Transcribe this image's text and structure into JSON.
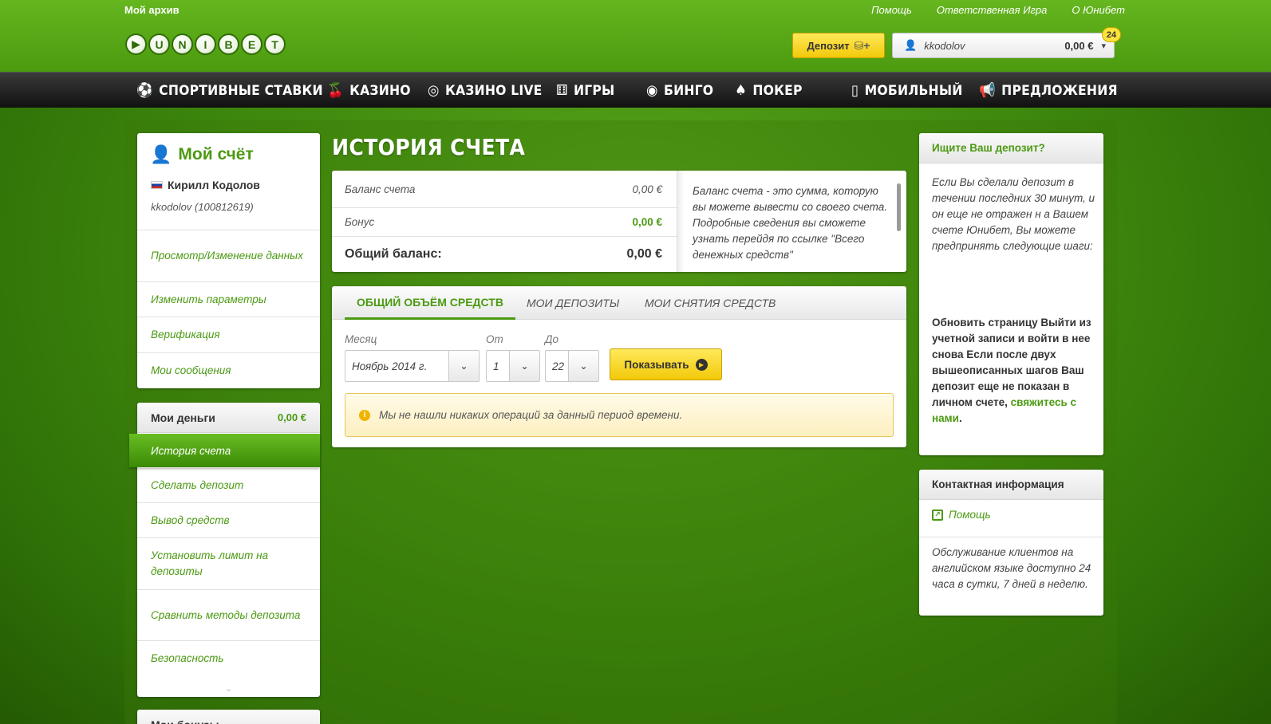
{
  "top": {
    "archive": "Мой архив",
    "links": [
      "Помощь",
      "Ответственная Игра",
      "О Юнибет"
    ],
    "logo_letters": [
      "▶",
      "U",
      "N",
      "I",
      "B",
      "E",
      "T"
    ],
    "deposit_button": "Депозит",
    "username": "kkodolov",
    "balance": "0,00 €",
    "notifications": "24"
  },
  "nav": [
    "СПОРТИВНЫЕ СТАВКИ",
    "КАЗИНО",
    "КАЗИНО LIVE",
    "ИГРЫ",
    "БИНГО",
    "ПОКЕР",
    "МОБИЛЬНЫЙ",
    "ПРЕДЛОЖЕНИЯ"
  ],
  "account": {
    "title": "Мой счёт",
    "name": "Кирилл Кодолов",
    "id": "kkodolov (100812619)",
    "menu": [
      "Просмотр/Изменение данных",
      "Изменить параметры",
      "Верификация",
      "Мои сообщения"
    ]
  },
  "money": {
    "title": "Мои деньги",
    "value": "0,00 €",
    "active": "История счета",
    "menu": [
      "Сделать депозит",
      "Вывод средств",
      "Установить лимит на депозиты",
      "Сравнить методы депозита",
      "Безопасность"
    ]
  },
  "bonus": {
    "title": "Мои бонусы"
  },
  "page_title": "ИСТОРИЯ СЧЕТА",
  "balance": {
    "rows": [
      {
        "label": "Баланс счета",
        "value": "0,00 €"
      },
      {
        "label": "Бонус",
        "value": "0,00 €"
      }
    ],
    "total_label": "Общий баланс:",
    "total_value": "0,00 €",
    "description": "Баланс счета - это сумма, которую вы можете вывести со своего счета. Подробные сведения вы сможете узнать перейдя по ссылке \"Всего денежных средств\""
  },
  "history": {
    "tabs": [
      "ОБЩИЙ ОБЪЁМ СРЕДСТВ",
      "МОИ ДЕПОЗИТЫ",
      "МОИ СНЯТИЯ СРЕДСТВ"
    ],
    "month_label": "Месяц",
    "from_label": "От",
    "to_label": "До",
    "month_value": "Ноябрь 2014 г.",
    "from_value": "1",
    "to_value": "22",
    "show_button": "Показывать",
    "notice": "Мы не нашли никаких операций за данный период времени."
  },
  "deposit_help": {
    "title": "Ищите Ваш депозит?",
    "body": "Если Вы сделали депозит в течении последних 30 минут, и он еще не отражен н а Вашем счете Юнибет,  Вы можете предпринять следующие шаги:",
    "steps": "Обновить страницу Выйти из учетной записи и войти в нее снова Если после двух вышеописанных шагов Ваш депозит еще не показан в личном счете,",
    "link": "свяжитесь с нами",
    "end": "."
  },
  "contact": {
    "title": "Контактная информация",
    "help": "Помощь",
    "text": "Обслуживание клиентов на английском языке доступно 24 часа в сутки, 7 дней в неделю."
  }
}
